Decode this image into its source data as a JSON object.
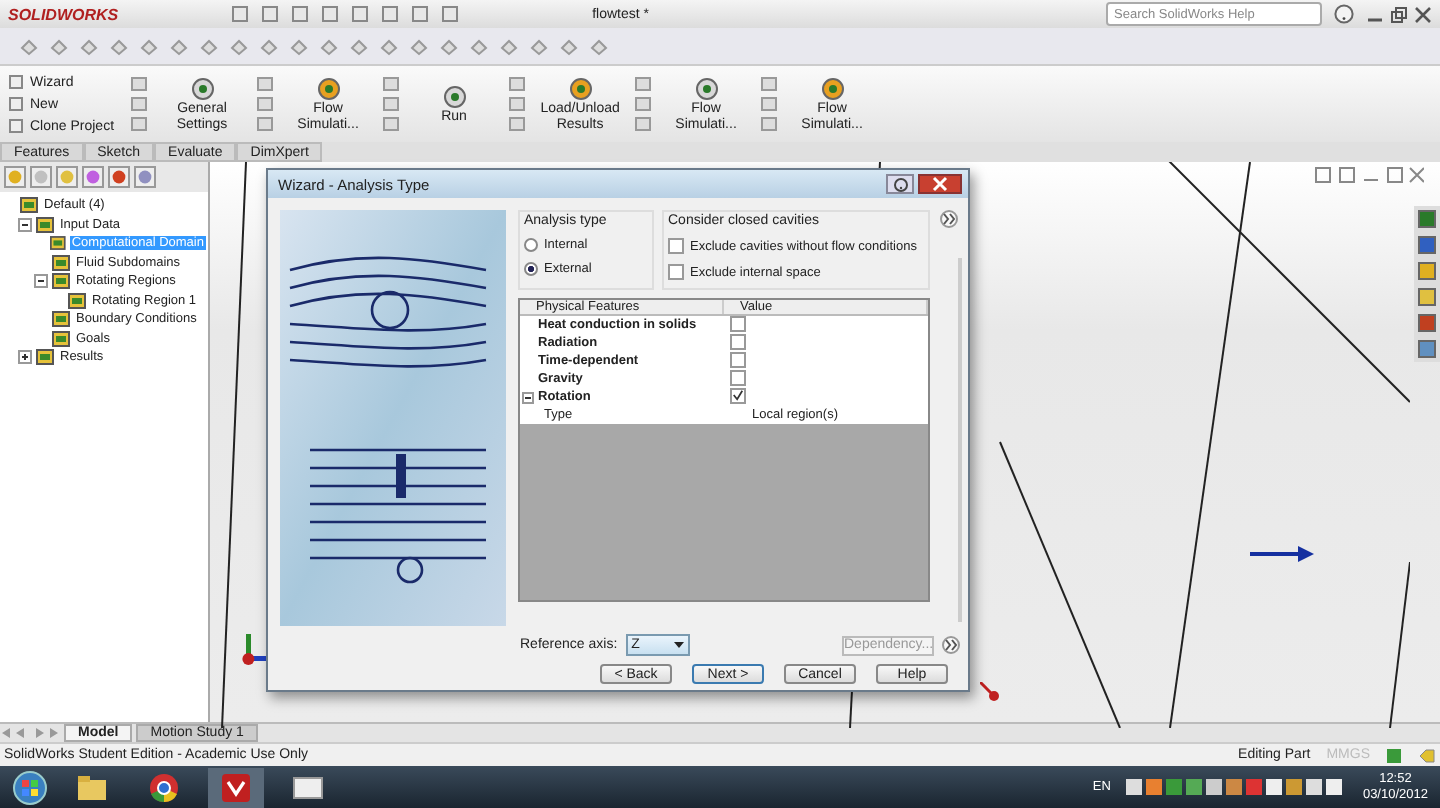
{
  "app": {
    "logo": "SOLIDWORKS",
    "title": "flowtest *",
    "search": {
      "placeholder": "Search SolidWorks Help"
    }
  },
  "ribbon": {
    "small_commands": [
      {
        "label": "Wizard"
      },
      {
        "label": "New"
      },
      {
        "label": "Clone Project"
      }
    ],
    "commands": [
      {
        "label": "General Settings"
      },
      {
        "label": "Flow Simulati..."
      },
      {
        "label": "Run"
      },
      {
        "label": "Load/Unload Results"
      },
      {
        "label": "Flow Simulati..."
      },
      {
        "label": "Flow Simulati..."
      }
    ]
  },
  "tabs": [
    {
      "label": "Features",
      "selected": false
    },
    {
      "label": "Sketch",
      "selected": false
    },
    {
      "label": "Evaluate",
      "selected": false
    },
    {
      "label": "DimXpert",
      "selected": false
    }
  ],
  "tree": [
    {
      "label": "Default (4)",
      "selected": false,
      "children": [
        {
          "label": "Input Data",
          "selected": false,
          "expanded": true,
          "children": [
            {
              "label": "Computational Domain",
              "selected": true
            },
            {
              "label": "Fluid Subdomains",
              "selected": false
            },
            {
              "label": "Rotating Regions",
              "selected": false,
              "expanded": true,
              "children": [
                {
                  "label": "Rotating Region 1",
                  "selected": false
                }
              ]
            },
            {
              "label": "Boundary Conditions",
              "selected": false
            },
            {
              "label": "Goals",
              "selected": false
            }
          ]
        },
        {
          "label": "Results",
          "selected": false,
          "expanded": false
        }
      ]
    }
  ],
  "dialog": {
    "title": "Wizard - Analysis Type",
    "analysis_type": {
      "title": "Analysis type",
      "options": [
        {
          "label": "Internal",
          "selected": false
        },
        {
          "label": "External",
          "selected": true
        }
      ]
    },
    "closed_cavities": {
      "title": "Consider closed cavities",
      "options": [
        {
          "label": "Exclude cavities without flow conditions",
          "checked": false
        },
        {
          "label": "Exclude internal space",
          "checked": false
        }
      ]
    },
    "table": {
      "columns": [
        "Physical Features",
        "Value"
      ],
      "rows": [
        {
          "label": "Heat conduction in solids",
          "checked": false
        },
        {
          "label": "Radiation",
          "checked": false
        },
        {
          "label": "Time-dependent",
          "checked": false
        },
        {
          "label": "Gravity",
          "checked": false
        },
        {
          "label": "Rotation",
          "checked": true,
          "expanded": true,
          "children": [
            {
              "label": "Type",
              "value": "Local region(s)"
            }
          ]
        }
      ]
    },
    "reference_axis": {
      "label": "Reference axis:",
      "value": "Z"
    },
    "dependency": {
      "label": "Dependency...",
      "disabled": true
    },
    "buttons": [
      "< Back",
      "Next >",
      "Cancel",
      "Help"
    ]
  },
  "model_tabs": [
    {
      "label": "Model",
      "selected": true
    },
    {
      "label": "Motion Study 1",
      "selected": false
    }
  ],
  "status_bar": {
    "left": "SolidWorks Student Edition - Academic Use Only",
    "mode": "Editing Part",
    "units": "MMGS"
  },
  "taskbar": {
    "language": "EN",
    "time": "12:52",
    "date": "03/10/2012"
  }
}
